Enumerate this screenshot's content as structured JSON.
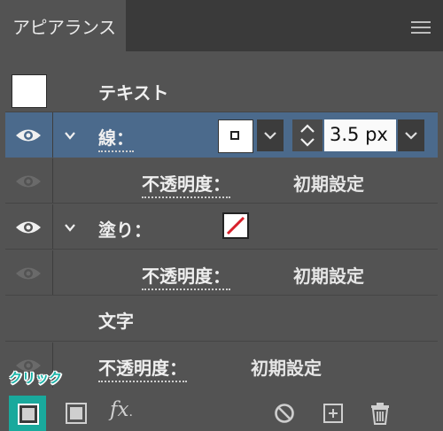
{
  "panel": {
    "tab_title": "アピアランス",
    "menu_icon": "hamburger-menu-icon"
  },
  "rows": {
    "text_item": {
      "label": "テキスト"
    },
    "stroke": {
      "label": "線：",
      "weight": "3.5 px"
    },
    "stroke_opacity": {
      "label": "不透明度：",
      "value": "初期設定"
    },
    "fill": {
      "label": "塗り："
    },
    "fill_opacity": {
      "label": "不透明度：",
      "value": "初期設定"
    },
    "characters": {
      "label": "文字"
    },
    "text_opacity": {
      "label": "不透明度：",
      "value": "初期設定"
    }
  },
  "annotation": {
    "label": "クリック",
    "color": "#1ab3a8"
  },
  "bottom_toolbar": {
    "icons": [
      "add-new-stroke-icon",
      "add-new-fill-icon",
      "add-effect-fx-icon",
      "clear-appearance-icon",
      "duplicate-item-icon",
      "delete-item-icon"
    ],
    "fx_label": "fx"
  },
  "colors": {
    "panel_bg": "#535353",
    "selected_row": "#4b6a8c",
    "fill_slash": "#d8202a"
  }
}
